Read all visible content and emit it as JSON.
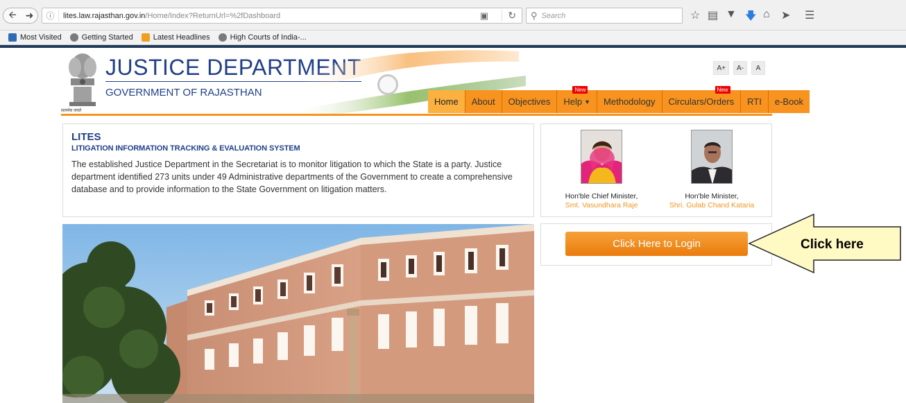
{
  "browser": {
    "url_host": "lites.law.rajasthan.gov.in",
    "url_path": "/Home/Index?ReturnUrl=%2fDashboard",
    "search_placeholder": "Search",
    "bookmarks": [
      {
        "label": "Most Visited",
        "icon": "bookmark-folder-icon"
      },
      {
        "label": "Getting Started",
        "icon": "globe-icon"
      },
      {
        "label": "Latest Headlines",
        "icon": "rss-icon"
      },
      {
        "label": "High Courts of India-...",
        "icon": "globe-icon"
      }
    ]
  },
  "header": {
    "title": "JUSTICE DEPARTMENT",
    "subtitle": "GOVERNMENT OF RAJASTHAN",
    "emblem_caption": "सत्यमेव जयते",
    "font_controls": [
      "A+",
      "A-",
      "A"
    ],
    "menu": [
      {
        "label": "Home",
        "new": false
      },
      {
        "label": "About",
        "new": false
      },
      {
        "label": "Objectives",
        "new": false
      },
      {
        "label": "Help",
        "new": true,
        "dropdown": true
      },
      {
        "label": "Methodology",
        "new": false
      },
      {
        "label": "Circulars/Orders",
        "new": true
      },
      {
        "label": "RTI",
        "new": false
      },
      {
        "label": "e-Book",
        "new": false
      }
    ],
    "new_badge": "New"
  },
  "lites": {
    "title": "LITES",
    "subtitle": "LITIGATION INFORMATION TRACKING & EVALUATION SYSTEM",
    "description": "The established Justice Department in the Secretariat is to monitor litigation to which the State is a party. Justice department identified 273 units under 49 Administrative departments of the Government to create a comprehensive database and to provide information to the State Government on litigation matters."
  },
  "ministers": [
    {
      "role": "Hon'ble Chief Minister,",
      "name": "Smt. Vasundhara Raje"
    },
    {
      "role": "Hon'ble Minister,",
      "name": "Shri. Gulab Chand Kataria"
    }
  ],
  "login": {
    "label": "Click Here to Login"
  },
  "callout": {
    "label": "Click here"
  },
  "colors": {
    "brand_blue": "#1f3f87",
    "menu_orange": "#f7931e",
    "accent_orange": "#f0951f"
  }
}
